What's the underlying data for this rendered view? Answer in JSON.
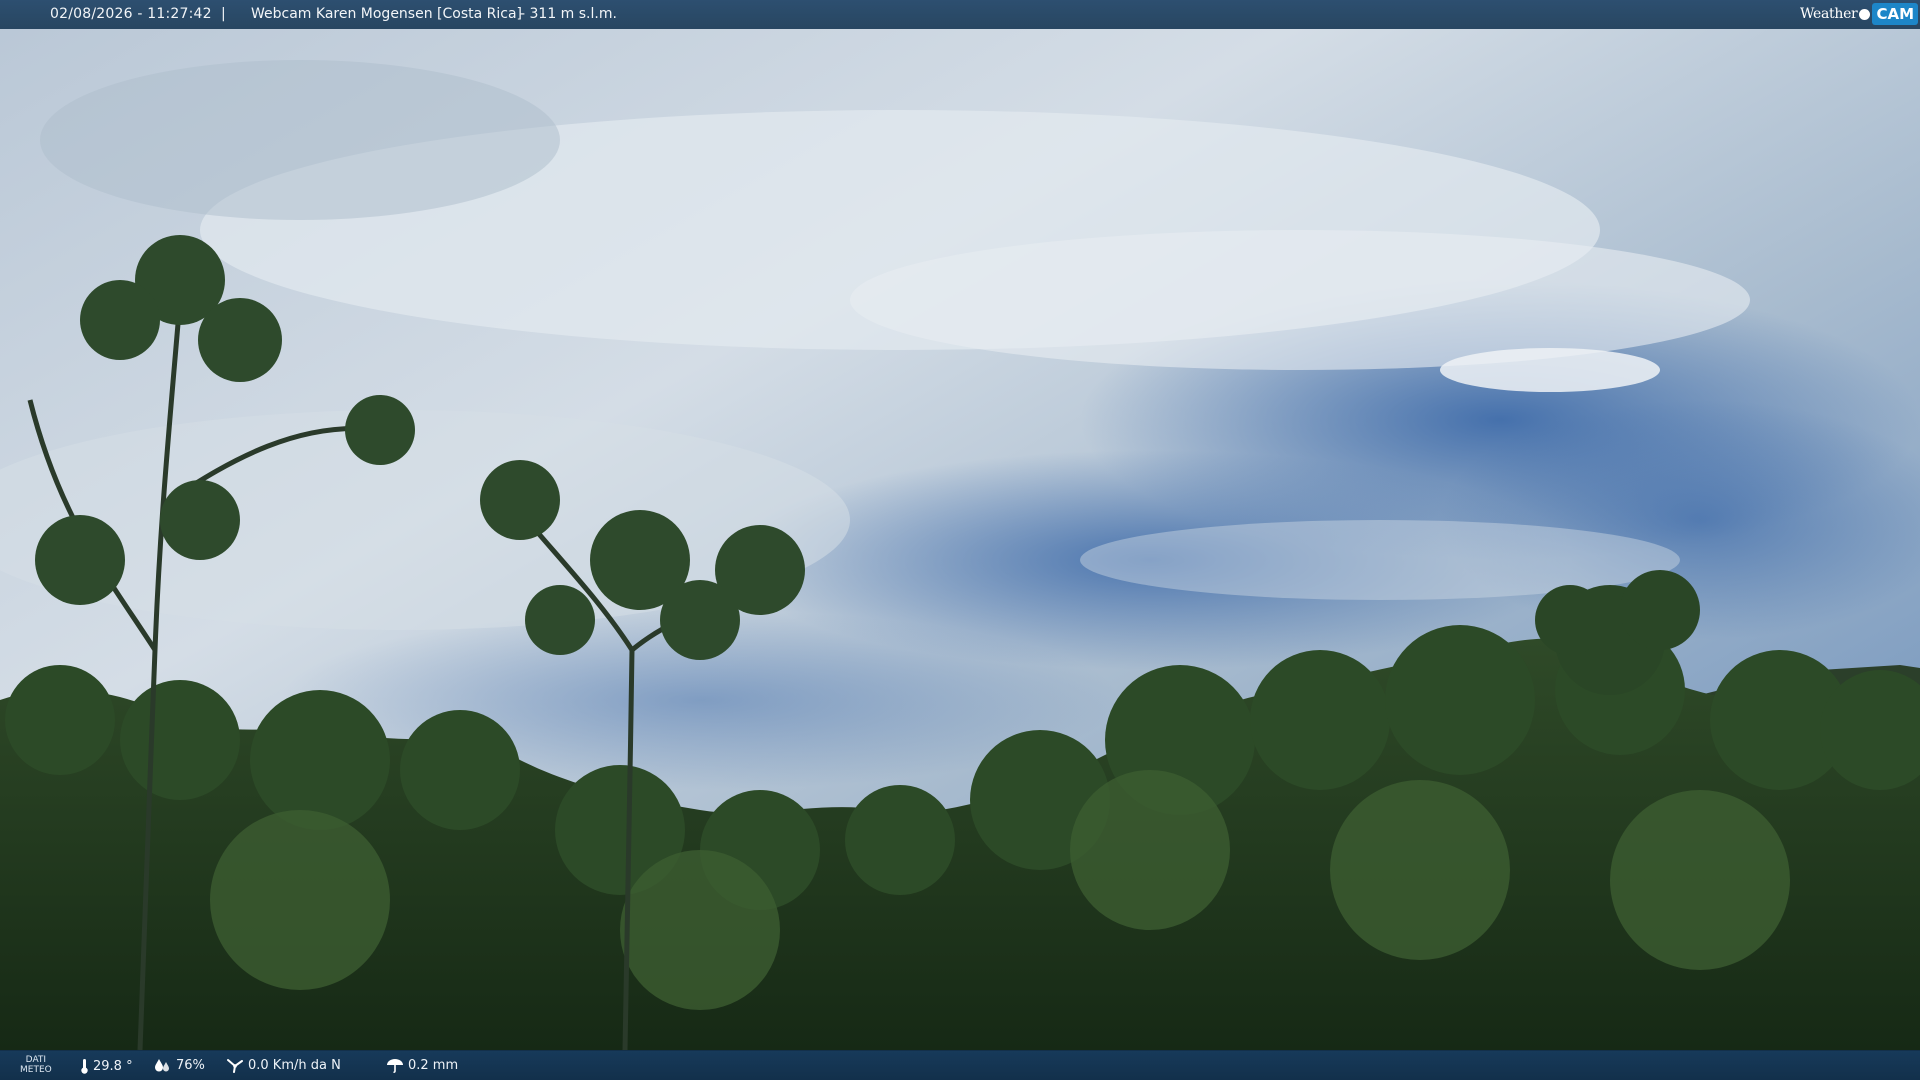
{
  "header": {
    "timestamp": "02/08/2026 - 11:27:42",
    "separator": "|",
    "camera_name": "Webcam Karen Mogensen [Costa Rica]",
    "altitude": "- 311 m s.l.m."
  },
  "logo": {
    "weather_text": "Weather",
    "cam_text": "CAM",
    "accent_color": "#1d86c8"
  },
  "footer": {
    "dati_line1": "DATI",
    "dati_line2": "METEO",
    "temperature": "29.8 °",
    "humidity": "76%",
    "wind": "0.0 Km/h da N",
    "rain": "0.2 mm",
    "icons": [
      "thermometer-icon",
      "humidity-drop-icon",
      "wind-icon",
      "rain-icon"
    ]
  },
  "colors": {
    "sky_top": "#c9d5e0",
    "sky_blue": "#3f6fae",
    "forest": "#1f3a1c",
    "bar": "#2b4a69"
  }
}
